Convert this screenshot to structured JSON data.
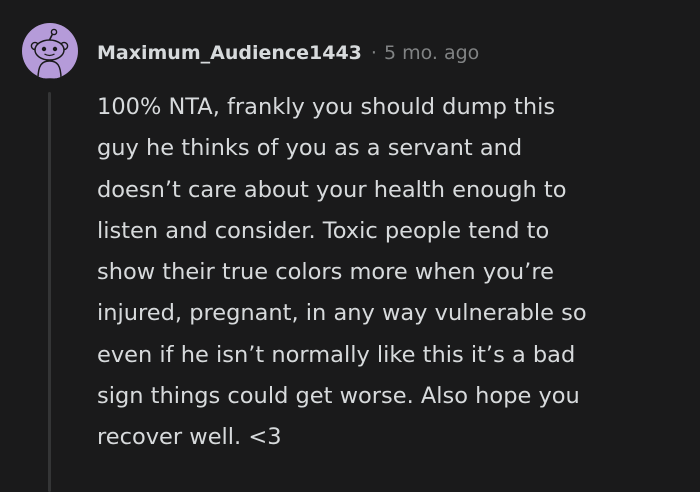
{
  "comment": {
    "username": "Maximum_Audience1443",
    "separator": "·",
    "timestamp": "5 mo. ago",
    "lines": [
      "100% NTA, frankly you should dump this",
      "guy he thinks of you as a servant and",
      "doesn’t care about your health enough to",
      "listen and consider. Toxic people tend to",
      "show their true colors more when you’re",
      "injured, pregnant, in any way vulnerable so",
      "even if he isn’t normally like this it’s a bad",
      "sign things could get worse. Also hope you",
      "recover well. <3"
    ]
  },
  "avatar": {
    "icon": "snoo-avatar-icon",
    "background": "#b59bd9"
  },
  "colors": {
    "background": "#1a1a1b",
    "text": "#d7dadc",
    "muted": "#818384",
    "thread_line": "#343536"
  }
}
